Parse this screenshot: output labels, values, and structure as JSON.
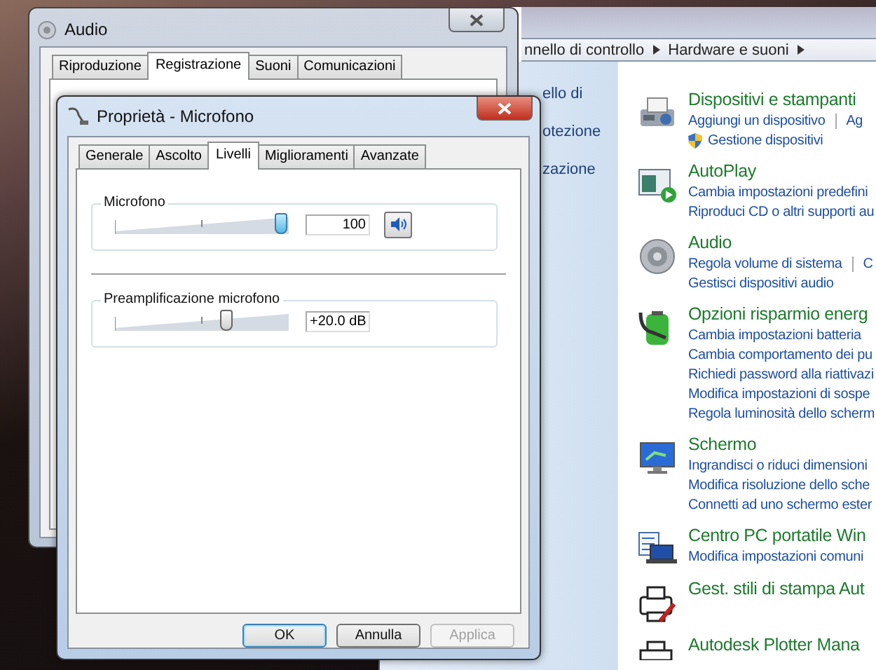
{
  "control_panel": {
    "breadcrumb": [
      "nnello di controllo",
      "Hardware e suoni"
    ],
    "side_links": [
      "ello di",
      "otezione",
      "zazione"
    ],
    "categories": [
      {
        "kind": "printer",
        "title": "Dispositivi e stampanti",
        "links": [
          [
            {
              "kind": "plain",
              "text": "Aggiungi un dispositivo"
            },
            {
              "kind": "plain",
              "text": "Ag"
            }
          ],
          [
            {
              "kind": "admin",
              "text": "Gestione dispositivi"
            }
          ]
        ]
      },
      {
        "kind": "autoplay",
        "title": "AutoPlay",
        "links": [
          [
            {
              "kind": "plain",
              "text": "Cambia impostazioni predefini"
            }
          ],
          [
            {
              "kind": "plain",
              "text": "Riproduci CD o altri supporti au"
            }
          ]
        ]
      },
      {
        "kind": "speaker",
        "title": "Audio",
        "links": [
          [
            {
              "kind": "plain",
              "text": "Regola volume di sistema"
            },
            {
              "kind": "plain",
              "text": "C"
            }
          ],
          [
            {
              "kind": "plain",
              "text": "Gestisci dispositivi audio"
            }
          ]
        ]
      },
      {
        "kind": "battery",
        "title": "Opzioni risparmio energ",
        "links": [
          [
            {
              "kind": "plain",
              "text": "Cambia impostazioni batteria"
            }
          ],
          [
            {
              "kind": "plain",
              "text": "Cambia comportamento dei pu"
            }
          ],
          [
            {
              "kind": "plain",
              "text": "Richiedi password alla riattivazi"
            }
          ],
          [
            {
              "kind": "plain",
              "text": "Modifica impostazioni di sospe"
            }
          ],
          [
            {
              "kind": "plain",
              "text": "Regola luminosità dello scherm"
            }
          ]
        ]
      },
      {
        "kind": "monitor",
        "title": "Schermo",
        "links": [
          [
            {
              "kind": "plain",
              "text": "Ingrandisci o riduci dimensioni"
            }
          ],
          [
            {
              "kind": "plain",
              "text": "Modifica risoluzione dello sche"
            }
          ],
          [
            {
              "kind": "plain",
              "text": "Connetti ad uno schermo ester"
            }
          ]
        ]
      },
      {
        "kind": "laptop",
        "title": "Centro PC portatile Win",
        "links": [
          [
            {
              "kind": "plain",
              "text": "Modifica impostazioni comuni"
            }
          ]
        ]
      },
      {
        "kind": "printer-pen",
        "title": "Gest. stili di stampa Aut"
      },
      {
        "kind": "plotter",
        "title": "Autodesk Plotter Mana"
      }
    ]
  },
  "audio_window": {
    "title": "Audio",
    "tabs": [
      {
        "label": "Riproduzione",
        "selected": false
      },
      {
        "label": "Registrazione",
        "selected": true
      },
      {
        "label": "Suoni",
        "selected": false
      },
      {
        "label": "Comunicazioni",
        "selected": false
      }
    ]
  },
  "properties_dialog": {
    "title": "Proprietà - Microfono",
    "tabs": [
      {
        "label": "Generale",
        "selected": false
      },
      {
        "label": "Ascolto",
        "selected": false
      },
      {
        "label": "Livelli",
        "selected": true
      },
      {
        "label": "Miglioramenti",
        "selected": false
      },
      {
        "label": "Avanzate",
        "selected": false
      }
    ],
    "groups": [
      {
        "kind": "volume",
        "label": "Microfono",
        "level": 1.0,
        "value": "100",
        "muted": false
      },
      {
        "kind": "boost",
        "label": "Preamplificazione microfono",
        "level": 0.66,
        "value": "+20.0 dB"
      }
    ],
    "buttons": [
      {
        "label": "OK",
        "default": true,
        "disabled": false
      },
      {
        "label": "Annulla",
        "default": false,
        "disabled": false
      },
      {
        "label": "Applica",
        "default": false,
        "disabled": true
      }
    ]
  }
}
